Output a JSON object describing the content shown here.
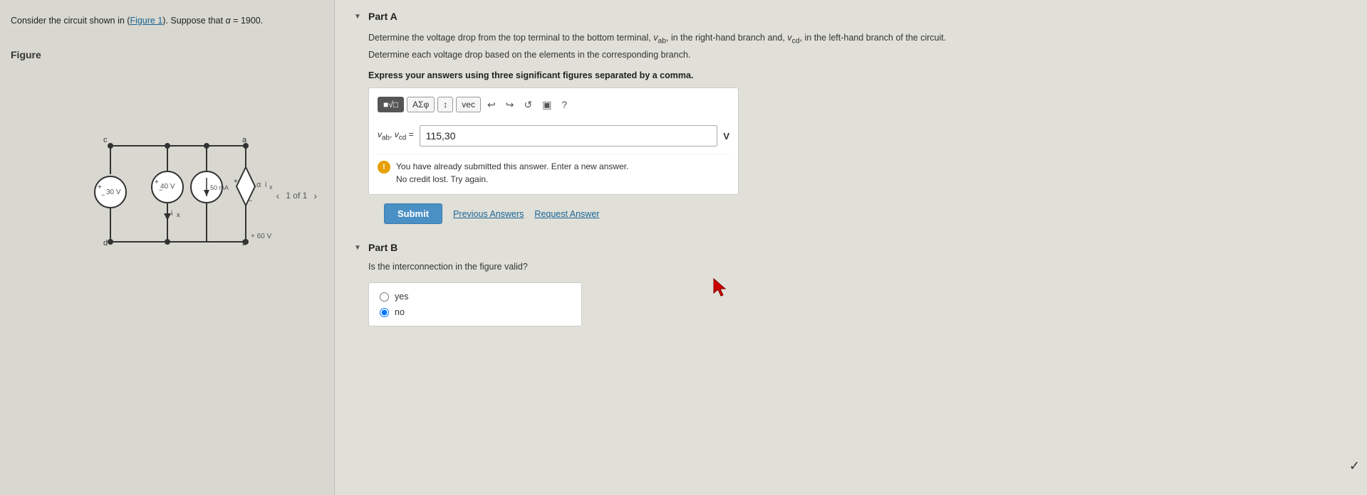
{
  "left": {
    "problem_text": "Consider the circuit shown in (Figure 1). Suppose that α = 1900.",
    "figure_link": "Figure 1",
    "figure_label": "Figure",
    "nav_current": "1 of 1"
  },
  "right": {
    "part_a": {
      "label": "Part A",
      "description_line1": "Determine the voltage drop from the top terminal to the bottom terminal, v",
      "description_sub1": "ab",
      "description_middle": ", in the right-hand branch and, v",
      "description_sub2": "cd",
      "description_end": ", in the left-hand branch of the circuit. Determine each voltage drop based on the elements in the corresponding branch.",
      "express_text": "Express your answers using three significant figures separated by a comma.",
      "toolbar": {
        "btn1": "■√□",
        "btn2": "ΑΣφ",
        "btn3": "↕",
        "btn4": "vec",
        "undo_icon": "↩",
        "redo_icon": "↪",
        "refresh_icon": "↺",
        "image_icon": "▣",
        "help_icon": "?"
      },
      "var_label": "v",
      "var_sub1": "ab",
      "var_sep": ", v",
      "var_sub2": "cd",
      "var_eq": " = ",
      "answer_value": "115,30",
      "unit": "V",
      "info_line1": "You have already submitted this answer. Enter a new answer.",
      "info_line2": "No credit lost. Try again.",
      "submit_label": "Submit",
      "previous_answers_label": "Previous Answers",
      "request_answer_label": "Request Answer"
    },
    "part_b": {
      "label": "Part B",
      "description": "Is the interconnection in the figure valid?",
      "options": [
        "yes",
        "no"
      ]
    }
  }
}
